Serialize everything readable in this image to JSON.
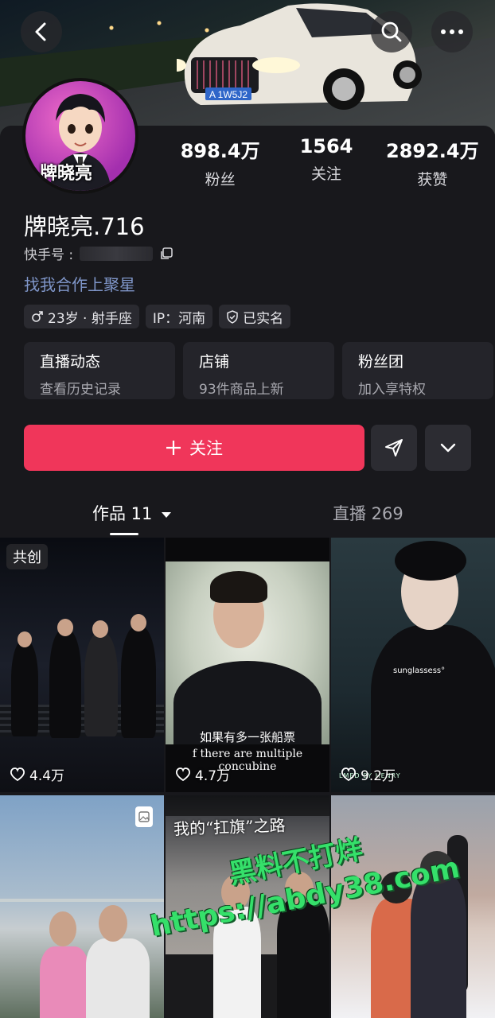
{
  "header": {
    "back_icon": "chevron-left-icon",
    "search_icon": "search-icon",
    "more_icon": "more-dots-icon",
    "plate": "A 1W5J2"
  },
  "profile": {
    "avatar_text": "牌晓亮",
    "stats": [
      {
        "num": "898.4万",
        "label": "粉丝"
      },
      {
        "num": "1564",
        "label": "关注"
      },
      {
        "num": "2892.4万",
        "label": "获赞"
      }
    ],
    "nickname": "牌晓亮.716",
    "kuaishou_label": "快手号 :",
    "promo": "找我合作上聚星",
    "tags": [
      {
        "icon": "male-icon",
        "text": "23岁 · 射手座"
      },
      {
        "icon": "",
        "text": "IP：河南"
      },
      {
        "icon": "shield-icon",
        "text": "已实名"
      }
    ],
    "cards": [
      {
        "title": "直播动态",
        "sub": "查看历史记录"
      },
      {
        "title": "店铺",
        "sub": "93件商品上新"
      },
      {
        "title": "粉丝团",
        "sub": "加入享特权"
      }
    ],
    "follow_label": "关注"
  },
  "tabs": {
    "works": "作品 11",
    "live": "直播 269"
  },
  "grid": {
    "items": [
      {
        "badge": "共创",
        "likes": "4.4万"
      },
      {
        "caption_cn": "如果有多一张船票",
        "caption_en": "f there are multiple concubine",
        "likes": "4.7万"
      },
      {
        "overlay": "sunglassess°",
        "credit": "LMED BY HENRY",
        "likes": "9.2万"
      },
      {},
      {
        "title": "我的“扛旗”之路"
      },
      {}
    ]
  },
  "watermark": {
    "line1": "黑料不打烊",
    "line2": "https://abdy38.com"
  },
  "colors": {
    "accent": "#f0365a",
    "link": "#7f96c9",
    "background": "#18181c"
  }
}
